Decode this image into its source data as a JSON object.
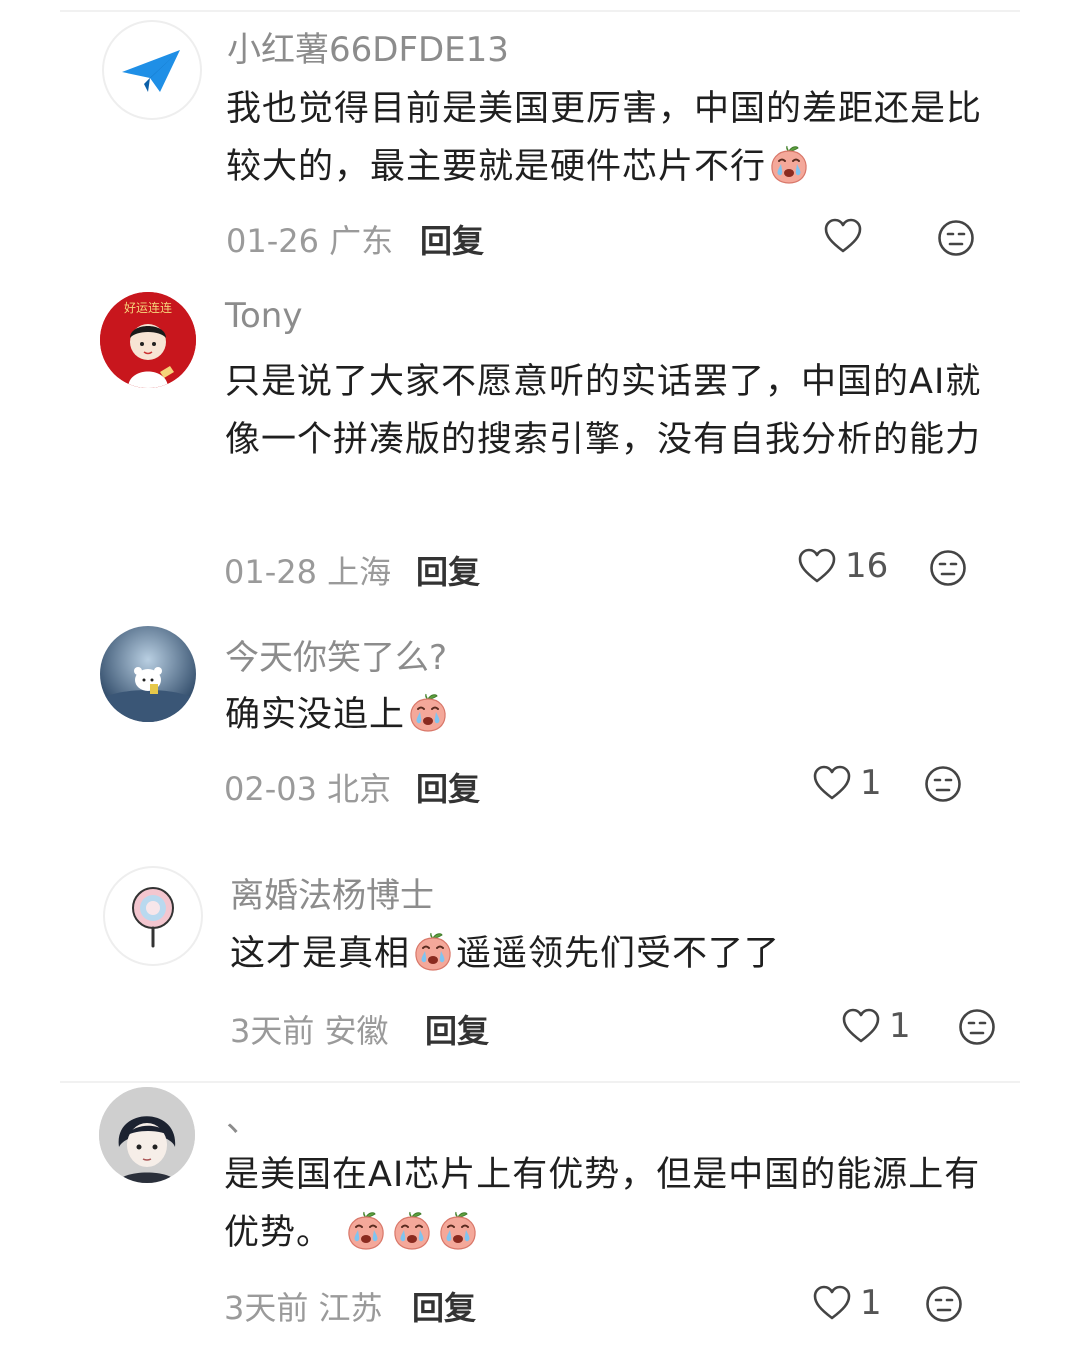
{
  "comments": [
    {
      "username": "小红薯66DFDE13",
      "text_parts": [
        "我也觉得目前是美国更厉害，中国的差距还是比较大的，最主要就是硬件芯片不行"
      ],
      "date": "01-26",
      "location": "广东",
      "reply_label": "回复",
      "likes": "",
      "avatar_icon": "paper-plane-icon"
    },
    {
      "username": "Tony",
      "text_parts": [
        "只是说了大家不愿意听的实话罢了，中国的AI就像一个拼凑版的搜索引擎，没有自我分析的能力"
      ],
      "date": "01-28",
      "location": "上海",
      "reply_label": "回复",
      "likes": "16",
      "avatar_icon": "boy-red-background-avatar",
      "avatar_text": "好运连连"
    },
    {
      "username": "今天你笑了么?",
      "text_parts": [
        "确实没追上"
      ],
      "date": "02-03",
      "location": "北京",
      "reply_label": "回复",
      "likes": "1",
      "avatar_icon": "polar-bear-avatar"
    },
    {
      "username": "离婚法杨博士",
      "text_parts": [
        "这才是真相",
        "遥遥领先们受不了了"
      ],
      "date": "3天前",
      "location": "安徽",
      "reply_label": "回复",
      "likes": "1",
      "avatar_icon": "lollipop-avatar"
    },
    {
      "username": "、",
      "text_parts": [
        "是美国在AI芯片上有优势，但是中国的能源上有优势。"
      ],
      "date": "3天前",
      "location": "江苏",
      "reply_label": "回复",
      "likes": "1",
      "avatar_icon": "anime-boy-avatar"
    }
  ],
  "icons": {
    "like": "heart-outline-icon",
    "dislike": "meh-face-icon",
    "emoji": "crying-peach-emoji"
  },
  "colors": {
    "username": "#8c8c8c",
    "meta": "#9a9a9a",
    "text": "#1f1f1f",
    "avatar_red": "#c8161d"
  }
}
